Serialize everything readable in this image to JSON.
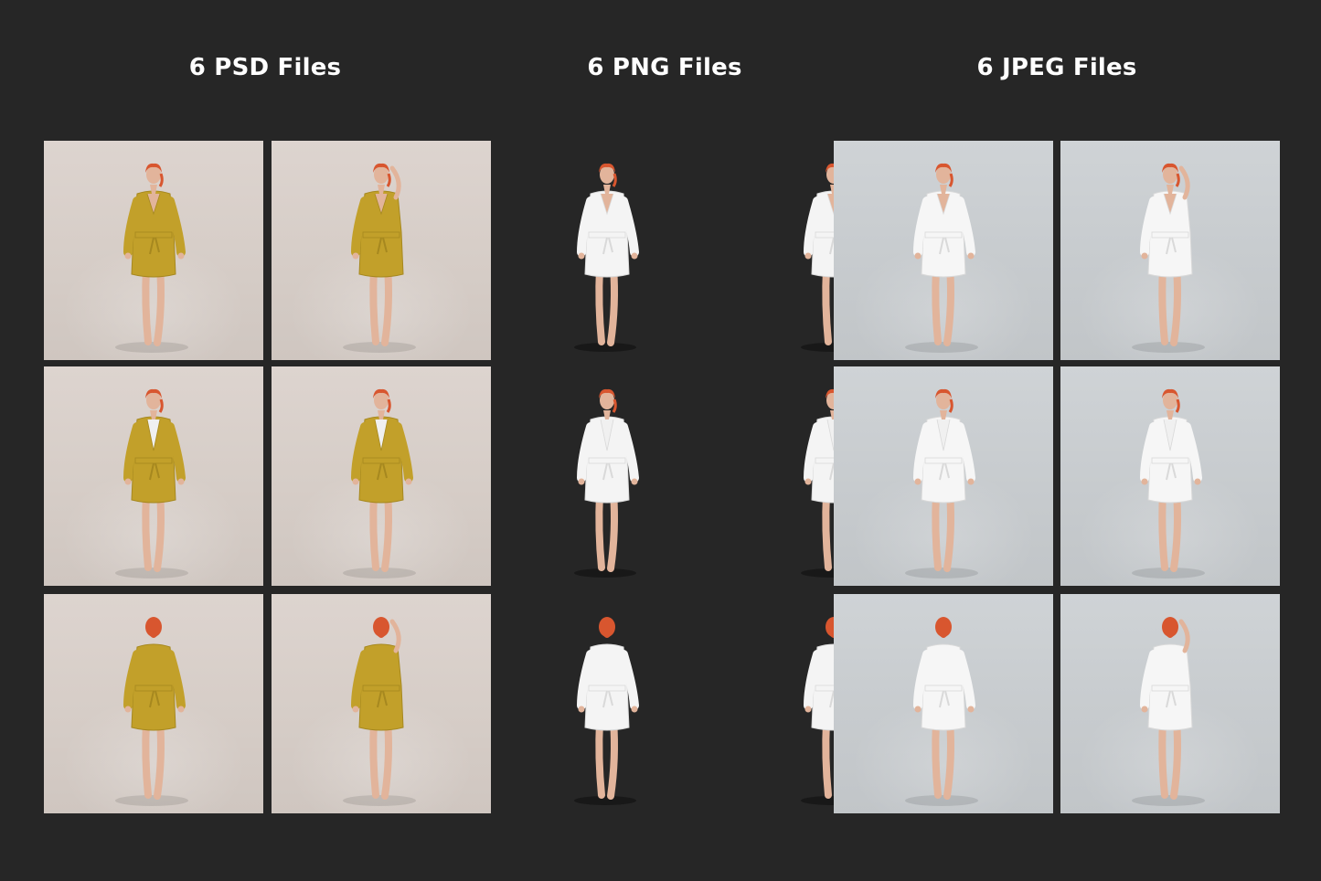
{
  "columns": [
    {
      "title": "6 PSD Files",
      "variant": "psd",
      "robe_color": "#c2a02a",
      "tiles": [
        {
          "view": "front"
        },
        {
          "view": "front-arm-up"
        },
        {
          "view": "front-open"
        },
        {
          "view": "front-open"
        },
        {
          "view": "back"
        },
        {
          "view": "back-arm-up"
        }
      ]
    },
    {
      "title": "6 PNG Files",
      "variant": "png",
      "robe_color": "#f4f4f4",
      "tiles": [
        {
          "view": "front"
        },
        {
          "view": "front-arm-up"
        },
        {
          "view": "front-open"
        },
        {
          "view": "front-open"
        },
        {
          "view": "back"
        },
        {
          "view": "back-arm-up"
        }
      ]
    },
    {
      "title": "6 JPEG Files",
      "variant": "jpeg",
      "robe_color": "#f6f6f6",
      "tiles": [
        {
          "view": "front"
        },
        {
          "view": "front-arm-up"
        },
        {
          "view": "front-open"
        },
        {
          "view": "front-open"
        },
        {
          "view": "back"
        },
        {
          "view": "back-arm-up"
        }
      ]
    }
  ],
  "colors": {
    "background": "#262626",
    "hair": "#d8562f",
    "skin": "#e2b49b"
  }
}
